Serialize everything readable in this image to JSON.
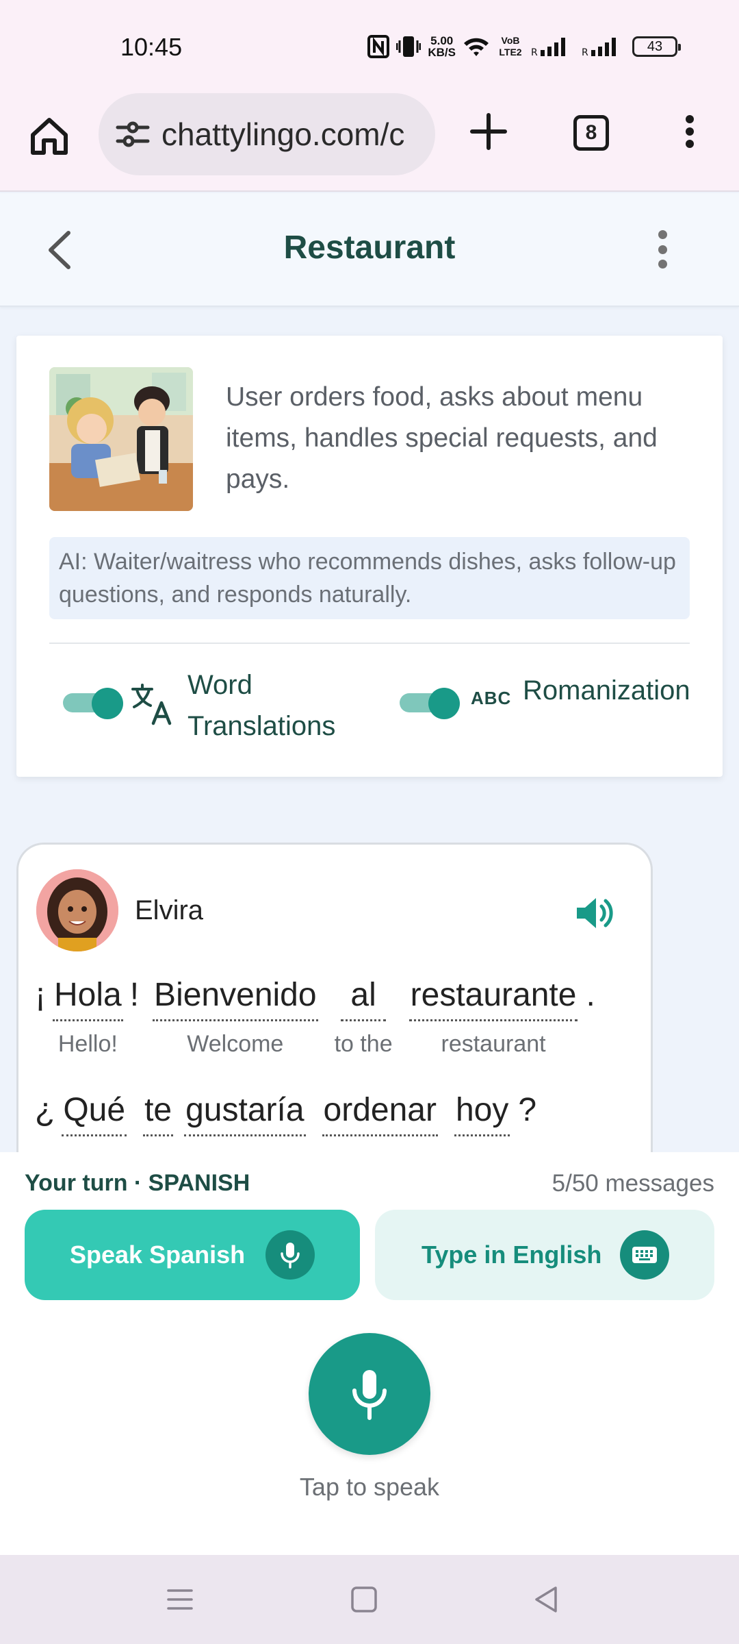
{
  "status": {
    "time": "10:45",
    "speed_value": "5.00",
    "speed_unit": "KB/S",
    "volte": "VoB LTE2",
    "battery": "43"
  },
  "browser": {
    "url": "chattylingo.com/c",
    "tab_count": "8"
  },
  "header": {
    "title": "Restaurant"
  },
  "scenario": {
    "description": "User orders food, asks about menu items, handles special requests, and pays.",
    "ai_role": "AI: Waiter/waitress who recommends dishes, asks follow-up questions, and responds naturally.",
    "toggle_word_translations": {
      "label": "Word Translations",
      "on": true
    },
    "toggle_romanization": {
      "label": "Romanization",
      "icon_text": "ABC",
      "on": true
    }
  },
  "message": {
    "speaker": "Elvira",
    "line1": {
      "open_punct": "¡",
      "words": [
        {
          "word": "Hola",
          "gloss": "Hello!"
        },
        {
          "word": "!",
          "gloss": ""
        },
        {
          "word": "Bienvenido",
          "gloss": "Welcome"
        },
        {
          "word": "al",
          "gloss": "to the"
        },
        {
          "word": "restaurante",
          "gloss": "restaurant"
        }
      ],
      "close_punct": "."
    },
    "line2": {
      "open_punct": "¿",
      "words": [
        {
          "word": "Qué",
          "gloss": ""
        },
        {
          "word": "te",
          "gloss": ""
        },
        {
          "word": "gustaría",
          "gloss": ""
        },
        {
          "word": "ordenar",
          "gloss": ""
        },
        {
          "word": "hoy",
          "gloss": ""
        }
      ],
      "close_punct": "?"
    }
  },
  "input": {
    "turn_label": "Your turn · SPANISH",
    "message_count": "5/50 messages",
    "speak_button": "Speak Spanish",
    "type_button": "Type in English",
    "tap_label": "Tap to speak"
  },
  "colors": {
    "accent": "#199a88",
    "accent_light": "#34c9b4",
    "title_text": "#1e4d45"
  },
  "icons": [
    "home-icon",
    "tune-icon",
    "plus-icon",
    "tabs-icon",
    "more-vert-icon",
    "back-icon",
    "translate-icon",
    "abc-icon",
    "volume-icon",
    "mic-icon",
    "keyboard-icon",
    "recents-icon",
    "home-square-icon",
    "nav-back-icon"
  ]
}
